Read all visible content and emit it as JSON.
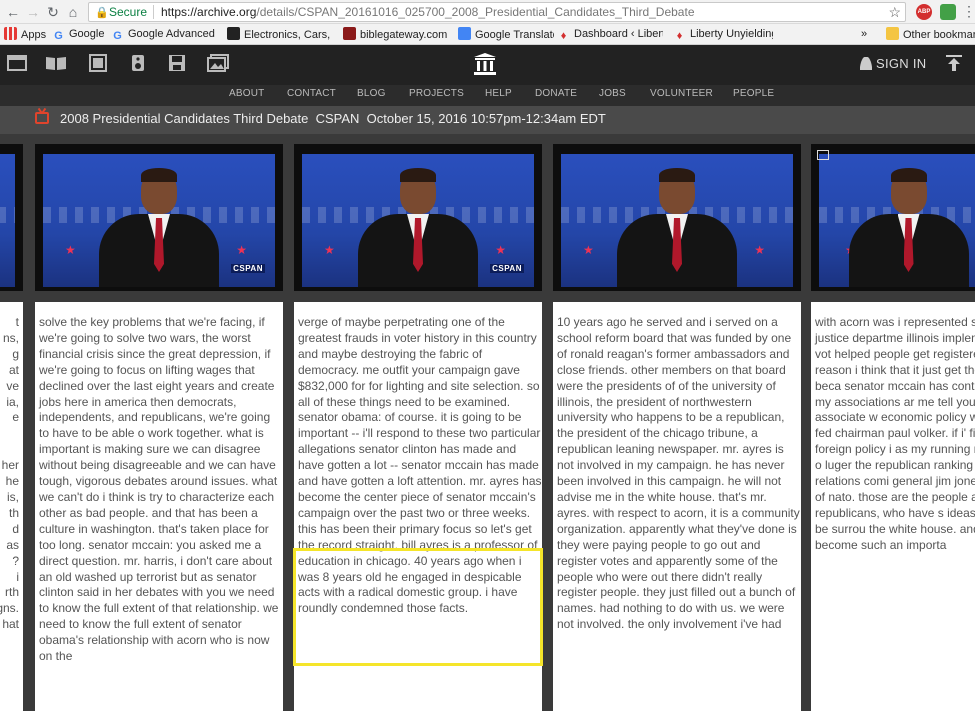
{
  "browser": {
    "secure_label": "Secure",
    "url_host": "https://archive.org",
    "url_path": "/details/CSPAN_20161016_025700_2008_Presidential_Candidates_Third_Debate",
    "extension_abp": "ABP",
    "bookmarks": [
      {
        "label": "Apps",
        "icon": "apps-grid-icon",
        "color": "#e53935"
      },
      {
        "label": "Google",
        "icon": "google-icon",
        "color": "#4285f4"
      },
      {
        "label": "Google Advanced Se",
        "icon": "google-icon",
        "color": "#4285f4"
      },
      {
        "label": "Electronics, Cars, Fasl",
        "icon": "ebay-icon",
        "color": "#111111"
      },
      {
        "label": "biblegateway.com A",
        "icon": "biblegateway-icon",
        "color": "#8b1a1a"
      },
      {
        "label": "Google Translate",
        "icon": "translate-icon",
        "color": "#4285f4"
      },
      {
        "label": "Dashboard ‹ Liberty",
        "icon": "flame-icon",
        "color": "#d32f2f"
      },
      {
        "label": "Liberty Unyielding",
        "icon": "flame-icon",
        "color": "#d32f2f"
      }
    ],
    "bookmarks_overflow": "»",
    "other_bookmarks": "Other bookmarks"
  },
  "archive": {
    "signin_label": "SIGN IN",
    "nav": [
      "ABOUT",
      "CONTACT",
      "BLOG",
      "PROJECTS",
      "HELP",
      "DONATE",
      "JOBS",
      "VOLUNTEER",
      "PEOPLE"
    ]
  },
  "item": {
    "title": "2008 Presidential Candidates Third Debate",
    "network": "CSPAN",
    "airdate": "October 15, 2016 10:57pm-12:34am EDT"
  },
  "thumbs": {
    "watermark": "CSPAN"
  },
  "transcript": {
    "col0": "t\nns,\ng\nat\nve\nia,\ne\n\n\nher\nhe\nis,\nth\nd\nas\n?\ni\nrth\ngns.\nhat",
    "col1": "solve the key problems that we're facing, if we're going to solve two wars, the worst financial crisis since the great depression, if we're going to focus on lifting wages that declined over the last eight years and create jobs here in america then democrats, independents, and republicans, we're going to have to be able o work together. what is important is making sure we can disagree without being disagreeable and we can have tough, vigorous debates around issues. what we can't do i think is try to characterize each other as bad people. and that has been a culture in washington. that's taken place for too long. senator mccain: you asked me a direct question. mr. harris, i don't care about an old washed up terrorist but as senator clinton said in her debates with you we need to know the full extent of that relationship. we need to know the full extent of senator obama's relationship with acorn who is now on the",
    "col2": "verge of maybe perpetrating one of the greatest frauds in voter history in this country and maybe destroying the fabric of democracy. me outfit your campaign gave $832,000 for for lighting and site selection. so all of these things need to be examined. senator obama: of course. it is going to be important -- i'll respond to these two particular allegations senator clinton has made and have gotten a lot -- senator mccain has made and have gotten a loft attention. mr. ayres has become the center piece of senator mccain's campaign over the past two or three weeks. this has been their primary focus so let's get the record straight. bill ayres is a professor of education in chicago. 40 years ago when i was 8 years old he engaged in despicable acts with a radical domestic group. i have roundly condemned those facts.",
    "col3": "10 years ago he served and i served on a school reform board that was funded by one of ronald reagan's former ambassadors and close friends. other members on that board were the presidents of of the university of illinois, the president of northwestern university who happens to be a republican, the president of the chicago tribune, a republican leaning newspaper. mr. ayres is not involved in my campaign. he has never been involved in this campaign. he will not advise me in the white house. that's mr. ayres. with respect to acorn, it is a community organization. apparently what they've done is they were paying people to go out and register votes and apparently some of the people who were out there didn't really register people. they just filled out a bunch of names. had nothing to do with us. we were not involved. the only involvement i've had",
    "col4": "with acorn was i represented side the u.s. justice departme illinois implement a motor vot helped people get registered now, the reason i think that it just get the facts out, is beca senator mccain has continua somehow my associations ar me tell you who i associate w economic policy warren buffe fed chairman paul volker. if i' figuring out foreign policy i as my running mate joe biden o luger the republican ranking senate foreign relations comi general jim jones the suprem of nato. those are the people and republicans, who have s ideas and who will be surrou the white house. and i think t has become such an importa"
  }
}
